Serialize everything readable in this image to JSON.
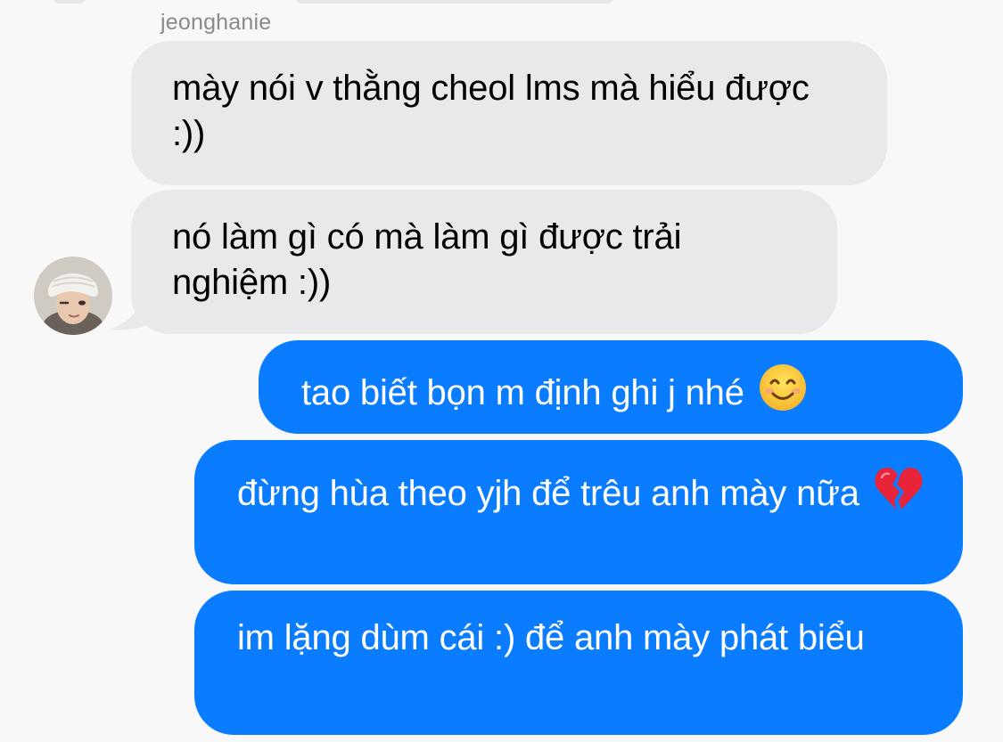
{
  "conversation": {
    "sender_name": "jeonghanie",
    "messages": [
      {
        "direction": "incoming",
        "text": "mày nói v thằng cheol lms mà hiểu được :))"
      },
      {
        "direction": "incoming",
        "text": "nó làm gì có mà làm gì được trải nghiệm :))"
      },
      {
        "direction": "outgoing",
        "text": "tao biết bọn m định ghi j nhé",
        "emoji": "smiling-face-emoji"
      },
      {
        "direction": "outgoing",
        "text": "đừng hùa theo yjh để trêu anh mày nữa",
        "emoji": "broken-heart-emoji"
      },
      {
        "direction": "outgoing",
        "text": "im lặng dùm cái :) để anh mày phát biểu"
      }
    ]
  },
  "colors": {
    "background": "#f8f8f8",
    "incoming_bubble": "#e9e9ec",
    "outgoing_bubble": "#0a7cff",
    "sender_name": "#8a8a8e"
  }
}
